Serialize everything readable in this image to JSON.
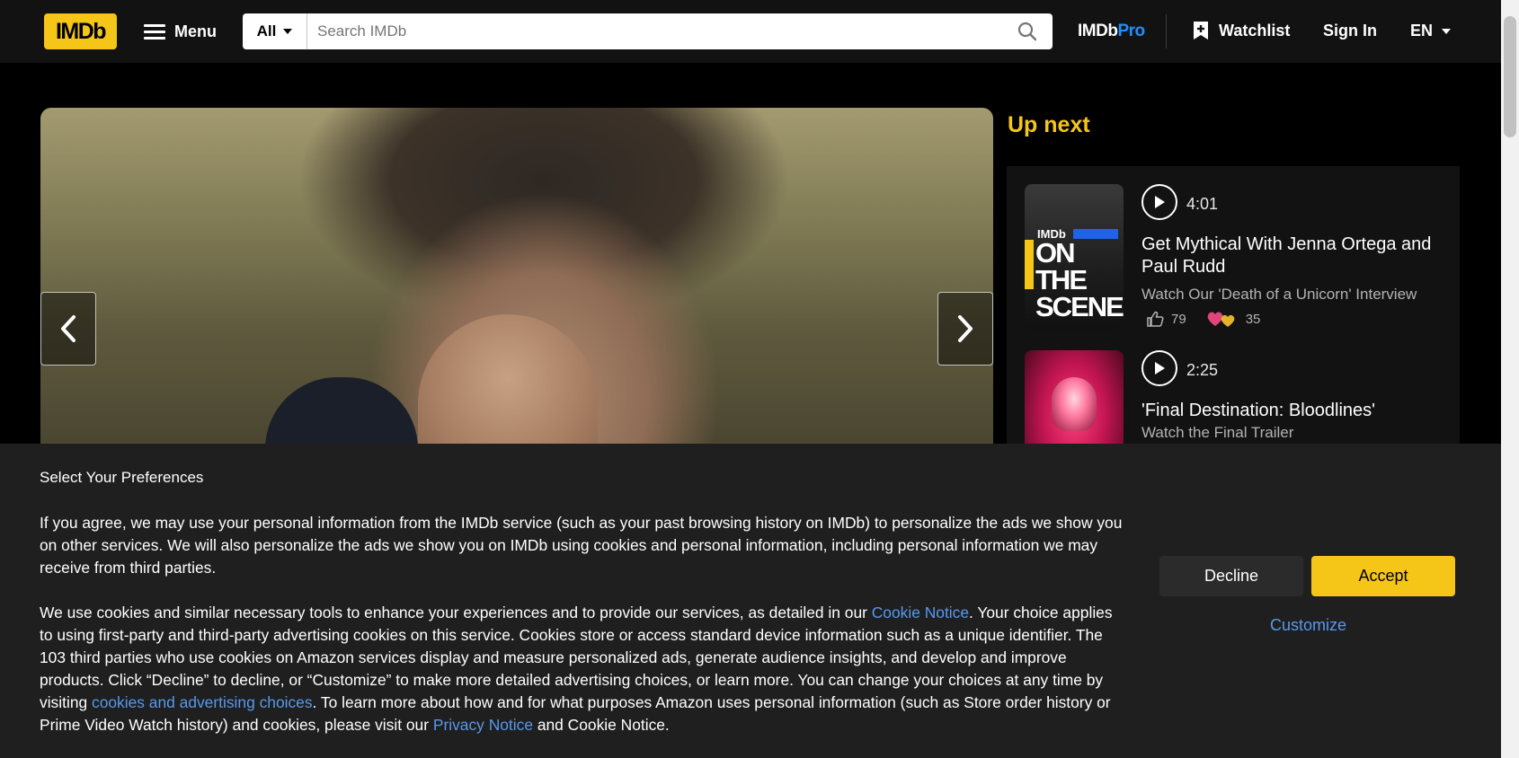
{
  "nav": {
    "logo": "IMDb",
    "menu_label": "Menu",
    "search_category": "All",
    "search_placeholder": "Search IMDb",
    "pro_a": "IMDb",
    "pro_b": "Pro",
    "watchlist": "Watchlist",
    "signin": "Sign In",
    "lang": "EN"
  },
  "upnext": {
    "title": "Up next",
    "items": [
      {
        "duration": "4:01",
        "title": "Get Mythical With Jenna Ortega and Paul Rudd",
        "subtitle": "Watch Our 'Death of a Unicorn' Interview",
        "likes": "79",
        "hearts": "35",
        "thumb_brand": "IMDb",
        "thumb_text_1": "ON THE",
        "thumb_text_2": "SCENE"
      },
      {
        "duration": "2:25",
        "title": "'Final Destination: Bloodlines'",
        "subtitle": "Watch the Final Trailer"
      }
    ]
  },
  "cookie": {
    "title": "Select Your Preferences",
    "p1": "If you agree, we may use your personal information from the IMDb service (such as your past browsing history on IMDb) to personalize the ads we show you on other services. We will also personalize the ads we show you on IMDb using cookies and personal information, including personal information we may receive from third parties.",
    "p2_a": "We use cookies and similar necessary tools to enhance your experiences and to provide our services, as detailed in our ",
    "p2_link1": "Cookie Notice",
    "p2_b": ". Your choice applies to using first-party and third-party advertising cookies on this service. Cookies store or access standard device information such as a unique identifier. The 103 third parties who use cookies on Amazon services display and measure personalized ads, generate audience insights, and develop and improve products. Click “Decline” to decline, or “Customize” to make more detailed advertising choices, or learn more. You can change your choices at any time by visiting ",
    "p2_link2": "cookies and advertising choices",
    "p2_c": ". To learn more about how and for what purposes Amazon uses personal information (such as Store order history or Prime Video Watch history) and cookies, please visit our ",
    "p2_link3": "Privacy Notice",
    "p2_d": " and Cookie Notice.",
    "decline": "Decline",
    "accept": "Accept",
    "customize": "Customize"
  },
  "colors": {
    "brand_yellow": "#f5c518",
    "link_blue": "#5799ef",
    "pro_blue": "#1e90ff"
  }
}
